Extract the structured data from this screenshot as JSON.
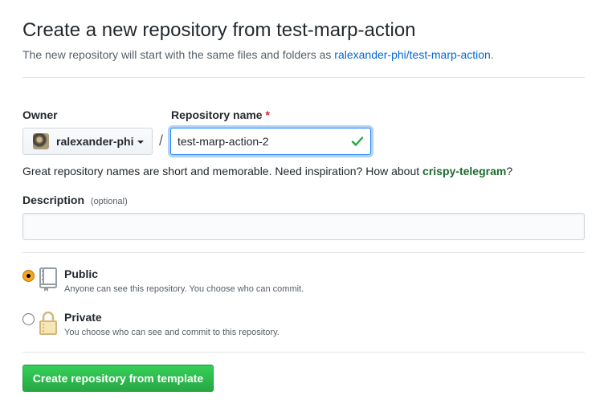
{
  "header": {
    "title": "Create a new repository from test-marp-action",
    "subtitle_prefix": "The new repository will start with the same files and folders as ",
    "template_link": "ralexander-phi/test-marp-action",
    "subtitle_suffix": "."
  },
  "owner": {
    "label": "Owner",
    "value": "ralexander-phi"
  },
  "separator": "/",
  "repo_name": {
    "label": "Repository name",
    "required_mark": "*",
    "value": "test-marp-action-2"
  },
  "hint": {
    "prefix": "Great repository names are short and memorable. Need inspiration? How about ",
    "suggestion": "crispy-telegram",
    "suffix": "?"
  },
  "description": {
    "label": "Description",
    "optional": "(optional)",
    "value": ""
  },
  "visibility": {
    "public": {
      "title": "Public",
      "desc": "Anyone can see this repository. You choose who can commit.",
      "checked": true
    },
    "private": {
      "title": "Private",
      "desc": "You choose who can see and commit to this repository.",
      "checked": false
    }
  },
  "submit_label": "Create repository from template",
  "colors": {
    "link": "#0366d6",
    "success_green": "#28a745",
    "radio_selected": "#f5a623"
  }
}
